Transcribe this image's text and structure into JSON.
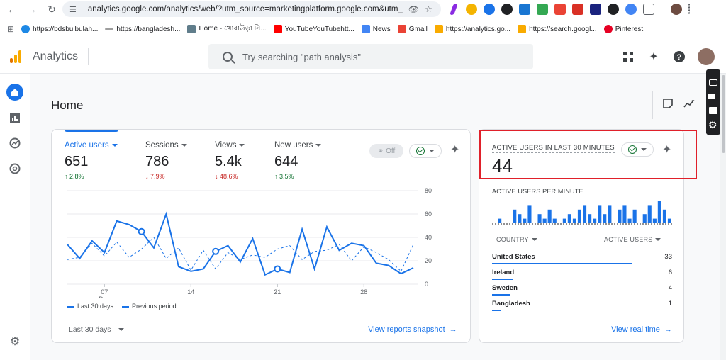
{
  "browser": {
    "url": "analytics.google.com/analytics/web/?utm_source=marketingplatform.google.com&utm_medi...",
    "bookmarks": [
      "https://bdsbulbulah...",
      "https://bangladesh...",
      "Home - খোরাউড়া নি...",
      "YouTubeYouTubehtt...",
      "News",
      "Gmail",
      "https://analytics.go...",
      "https://search.googl...",
      "Pinterest"
    ]
  },
  "header": {
    "app_name": "Analytics",
    "search_placeholder": "Try searching \"path analysis\""
  },
  "page": {
    "title": "Home"
  },
  "overview": {
    "metrics": [
      {
        "label": "Active users",
        "value": "651",
        "change": "2.8%",
        "direction": "up"
      },
      {
        "label": "Sessions",
        "value": "786",
        "change": "7.9%",
        "direction": "down"
      },
      {
        "label": "Views",
        "value": "5.4k",
        "change": "48.6%",
        "direction": "down"
      },
      {
        "label": "New users",
        "value": "644",
        "change": "3.5%",
        "direction": "up"
      }
    ],
    "off_label": "Off",
    "legend": {
      "current": "Last 30 days",
      "previous": "Previous period"
    },
    "range_label": "Last 30 days",
    "snapshot_link": "View reports snapshot"
  },
  "chart_data": {
    "type": "line",
    "x_ticks": [
      "07",
      "14",
      "21",
      "28"
    ],
    "x_month_label": "Dec",
    "y_ticks": [
      "80",
      "60",
      "40",
      "20",
      "0"
    ],
    "ylim": [
      0,
      80
    ],
    "series": [
      {
        "name": "Last 30 days",
        "style": "solid",
        "values": [
          34,
          22,
          37,
          27,
          54,
          51,
          45,
          31,
          60,
          15,
          11,
          13,
          28,
          33,
          19,
          39,
          8,
          13,
          10,
          47,
          13,
          49,
          29,
          35,
          33,
          18,
          16,
          9,
          14
        ]
      },
      {
        "name": "Previous period",
        "style": "dashed",
        "values": [
          21,
          23,
          35,
          24,
          36,
          23,
          30,
          40,
          22,
          31,
          12,
          29,
          13,
          27,
          21,
          25,
          23,
          30,
          33,
          21,
          28,
          29,
          34,
          20,
          32,
          27,
          21,
          11,
          34
        ]
      }
    ],
    "markers_at_index": [
      6,
      12,
      17
    ]
  },
  "realtime": {
    "heading": "ACTIVE USERS IN LAST 30 MINUTES",
    "count": "44",
    "per_minute_label": "ACTIVE USERS PER MINUTE",
    "per_minute_bars": [
      0,
      1,
      0,
      0,
      3,
      2,
      1,
      4,
      0,
      2,
      1,
      3,
      1,
      0,
      1,
      2,
      1,
      3,
      4,
      2,
      1,
      4,
      2,
      4,
      0,
      3,
      4,
      1,
      3,
      0,
      2,
      4,
      1,
      5,
      3,
      1
    ],
    "col_country": "COUNTRY",
    "col_users": "ACTIVE USERS",
    "rows": [
      {
        "country": "United States",
        "value": "33",
        "share": 0.78
      },
      {
        "country": "Ireland",
        "value": "6",
        "share": 0.12
      },
      {
        "country": "Sweden",
        "value": "4",
        "share": 0.1
      },
      {
        "country": "Bangladesh",
        "value": "1",
        "share": 0.05
      }
    ],
    "realtime_link": "View real time"
  },
  "colors": {
    "accent": "#1a73e8",
    "up": "#137333",
    "down": "#c5221f",
    "highlight": "#e0202a"
  }
}
